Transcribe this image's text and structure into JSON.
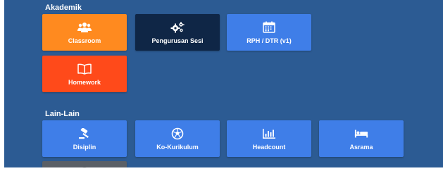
{
  "sections": {
    "akademik": {
      "title": "Akademik"
    },
    "lain_lain": {
      "title": "Lain-Lain"
    }
  },
  "tiles": {
    "classroom": {
      "label": "Classroom",
      "icon": "users-icon",
      "color": "#ff8a1f"
    },
    "pengurusan_sesi": {
      "label": "Pengurusan Sesi",
      "icon": "gears-icon",
      "color": "#0f2646"
    },
    "rph_dtr": {
      "label": "RPH / DTR (v1)",
      "icon": "calendar-icon",
      "color": "#3f7ee8"
    },
    "homework": {
      "label": "Homework",
      "icon": "book-icon",
      "color": "#ff4a1a"
    },
    "disiplin": {
      "label": "Disiplin",
      "icon": "gavel-icon",
      "color": "#3f7ee8"
    },
    "ko_kurikulum": {
      "label": "Ko-Kurikulum",
      "icon": "soccer-ball-icon",
      "color": "#3f7ee8"
    },
    "headcount": {
      "label": "Headcount",
      "icon": "bar-chart-icon",
      "color": "#3f7ee8"
    },
    "asrama": {
      "label": "Asrama",
      "icon": "bed-icon",
      "color": "#3f7ee8"
    },
    "partial_tile": {
      "color": "#5a5f66"
    }
  },
  "colors": {
    "background": "#2c5b93",
    "text": "#ffffff"
  }
}
